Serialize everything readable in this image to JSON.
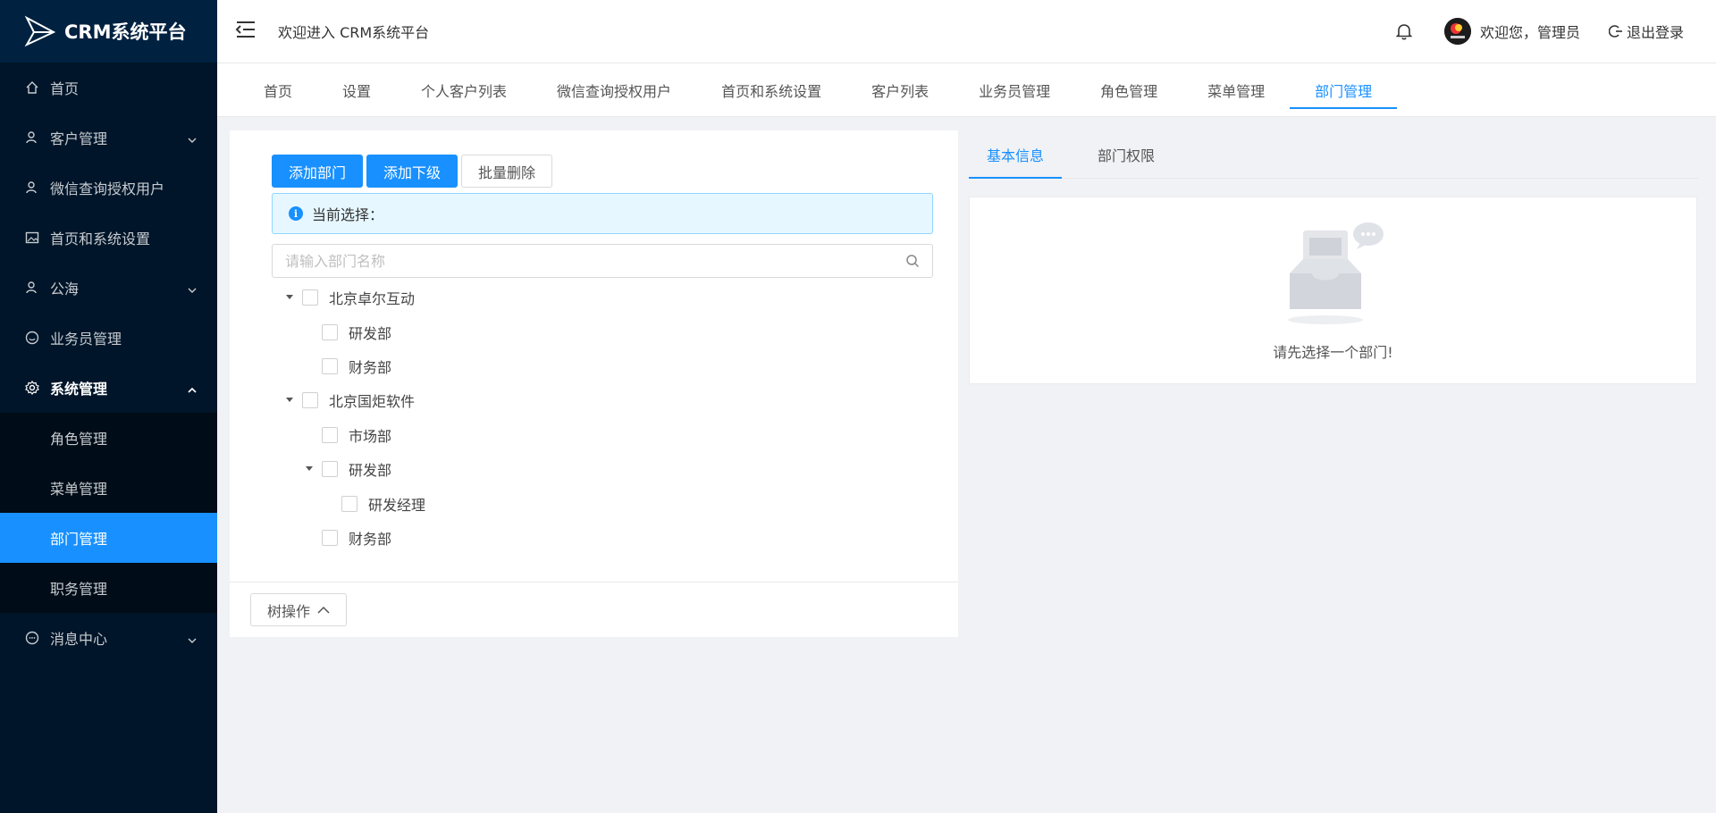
{
  "app": {
    "title": "CRM系统平台"
  },
  "sidebar": {
    "items": [
      {
        "label": "首页",
        "icon": "home-icon"
      },
      {
        "label": "客户管理",
        "icon": "user-icon",
        "has_arrow": true
      },
      {
        "label": "微信查询授权用户",
        "icon": "user-icon"
      },
      {
        "label": "首页和系统设置",
        "icon": "image-icon"
      },
      {
        "label": "公海",
        "icon": "user-icon",
        "has_arrow": true
      },
      {
        "label": "业务员管理",
        "icon": "smile-icon"
      },
      {
        "label": "系统管理",
        "icon": "gear-icon",
        "expanded": true
      },
      {
        "label": "消息中心",
        "icon": "message-icon",
        "has_arrow": true
      }
    ],
    "submenu": [
      {
        "label": "角色管理"
      },
      {
        "label": "菜单管理"
      },
      {
        "label": "部门管理",
        "active": true
      },
      {
        "label": "职务管理"
      }
    ]
  },
  "header": {
    "welcome": "欢迎进入 CRM系统平台",
    "user_text": "欢迎您，管理员",
    "logout": "退出登录"
  },
  "tabs": [
    "首页",
    "设置",
    "个人客户列表",
    "微信查询授权用户",
    "首页和系统设置",
    "客户列表",
    "业务员管理",
    "角色管理",
    "菜单管理",
    "部门管理"
  ],
  "active_tab": "部门管理",
  "left": {
    "buttons": {
      "add_dept": "添加部门",
      "add_child": "添加下级",
      "batch_delete": "批量删除"
    },
    "alert": "当前选择：",
    "search_placeholder": "请输入部门名称",
    "tree": [
      {
        "label": "北京卓尔互动",
        "level": 0,
        "expanded": true
      },
      {
        "label": "研发部",
        "level": 1
      },
      {
        "label": "财务部",
        "level": 1
      },
      {
        "label": "北京国炬软件",
        "level": 0,
        "expanded": true
      },
      {
        "label": "市场部",
        "level": 1
      },
      {
        "label": "研发部",
        "level": 1,
        "expanded": true
      },
      {
        "label": "研发经理",
        "level": 2
      },
      {
        "label": "财务部",
        "level": 1
      }
    ],
    "tree_ops": "树操作"
  },
  "right": {
    "tabs": [
      "基本信息",
      "部门权限"
    ],
    "active_tab": "基本信息",
    "empty_text": "请先选择一个部门!"
  },
  "colors": {
    "primary": "#1890ff",
    "sidebar_bg": "#001529",
    "submenu_bg": "#000c17"
  }
}
